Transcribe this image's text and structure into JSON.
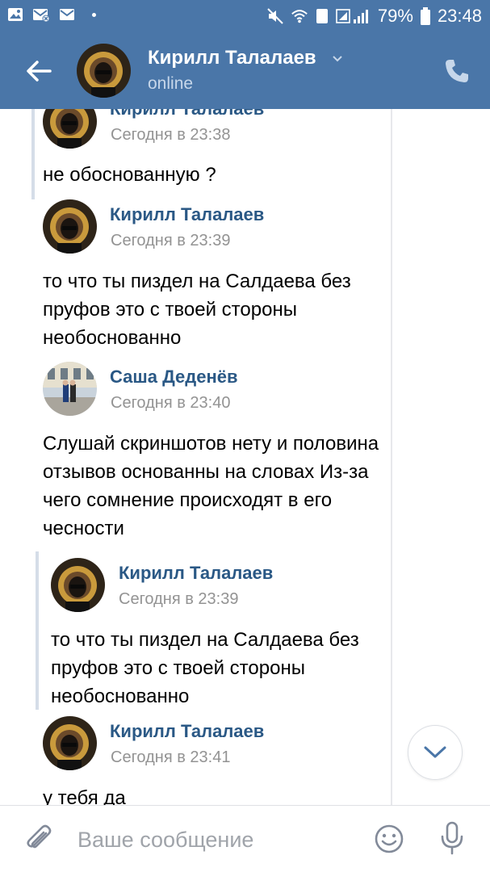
{
  "status_bar": {
    "battery": "79%",
    "time": "23:48",
    "sim_badge": "1",
    "icons": [
      "gallery-icon",
      "mail-off-icon",
      "mail-icon",
      "mute-icon",
      "wifi-icon",
      "signal-icon",
      "battery-icon"
    ]
  },
  "header": {
    "name": "Кирилл Талалаев",
    "status": "online"
  },
  "messages": [
    {
      "sender": "Кирилл Талалаев",
      "time": "Сегодня в 23:38",
      "text": "не обоснованную ?"
    },
    {
      "sender": "Кирилл Талалаев",
      "time": "Сегодня в 23:39",
      "text": "то что ты пиздел на Салдаева без пруфов это с твоей стороны необоснованно"
    },
    {
      "sender": "Саша Деденёв",
      "time": "Сегодня в 23:40",
      "text": "Слушай скриншотов нету и половина отзывов основанны на словах Из-за чего сомнение происходят в его чесности"
    },
    {
      "sender": "Кирилл Талалаев",
      "time": "Сегодня в 23:39",
      "text": "то что ты пиздел на Салдаева без пруфов это с твоей стороны необоснованно"
    },
    {
      "sender": "Кирилл Талалаев",
      "time": "Сегодня в 23:41",
      "text": "у тебя да"
    }
  ],
  "input": {
    "placeholder": "Ваше сообщение"
  },
  "colors": {
    "header_bg": "#4a76a8",
    "sender": "#2a5885",
    "time": "#939393"
  }
}
